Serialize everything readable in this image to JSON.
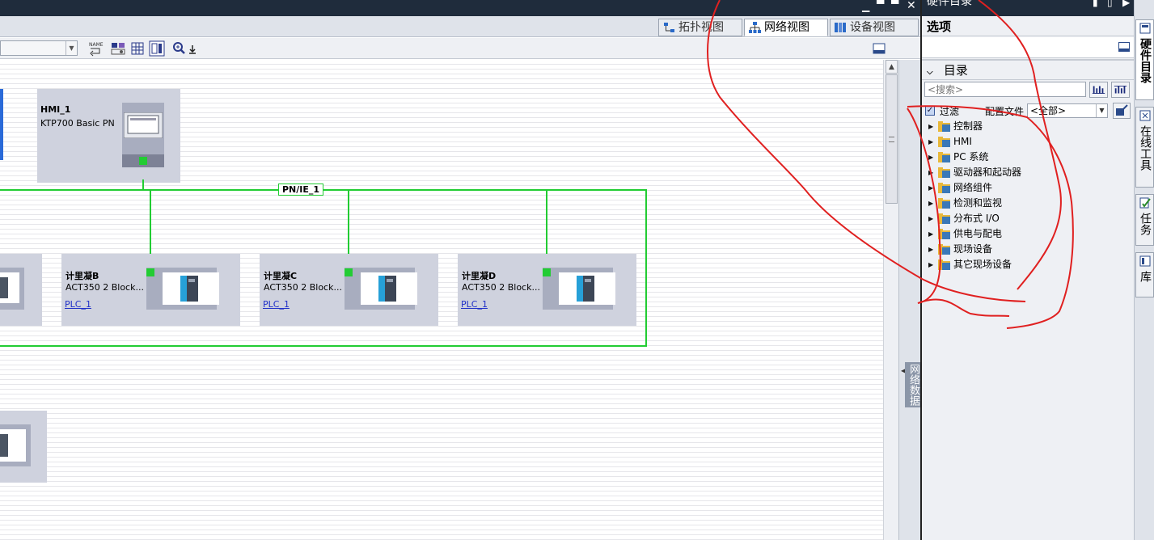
{
  "view_tabs": [
    {
      "label": "拓扑视图",
      "active": false
    },
    {
      "label": "网络视图",
      "active": true
    },
    {
      "label": "设备视图",
      "active": false
    }
  ],
  "network": {
    "subnet_label": "PN/IE_1",
    "hmi": {
      "name": "HMI_1",
      "type": "KTP700 Basic PN"
    },
    "devices": [
      {
        "name": "计里凝B",
        "type": "ACT350 2 Block...",
        "link": "PLC_1"
      },
      {
        "name": "计里凝C",
        "type": "ACT350 2 Block...",
        "link": "PLC_1"
      },
      {
        "name": "计里凝D",
        "type": "ACT350 2 Block...",
        "link": "PLC_1"
      }
    ]
  },
  "side_panel": {
    "network_data_label": "网络数据"
  },
  "catalog": {
    "title": "硬件目录",
    "options_header": "选项",
    "catalog_header": "目录",
    "search_placeholder": "<搜索>",
    "filter_label": "过滤",
    "profile_label": "配置文件",
    "profile_value": "<全部>",
    "tree_items": [
      {
        "label": "控制器"
      },
      {
        "label": "HMI"
      },
      {
        "label": "PC 系统"
      },
      {
        "label": "驱动器和起动器"
      },
      {
        "label": "网络组件"
      },
      {
        "label": "检测和监视"
      },
      {
        "label": "分布式 I/O"
      },
      {
        "label": "供电与配电"
      },
      {
        "label": "现场设备"
      },
      {
        "label": "其它现场设备"
      }
    ]
  },
  "task_tabs": [
    {
      "label": "硬件目录",
      "active": true
    },
    {
      "label": "在线工具",
      "active": false
    },
    {
      "label": "任务",
      "active": false
    },
    {
      "label": "库",
      "active": false
    }
  ],
  "colors": {
    "subnet": "#22cc33",
    "device_bg": "#cfd2de",
    "annotation": "#e02020",
    "titlebar": "#1f2c3c"
  }
}
